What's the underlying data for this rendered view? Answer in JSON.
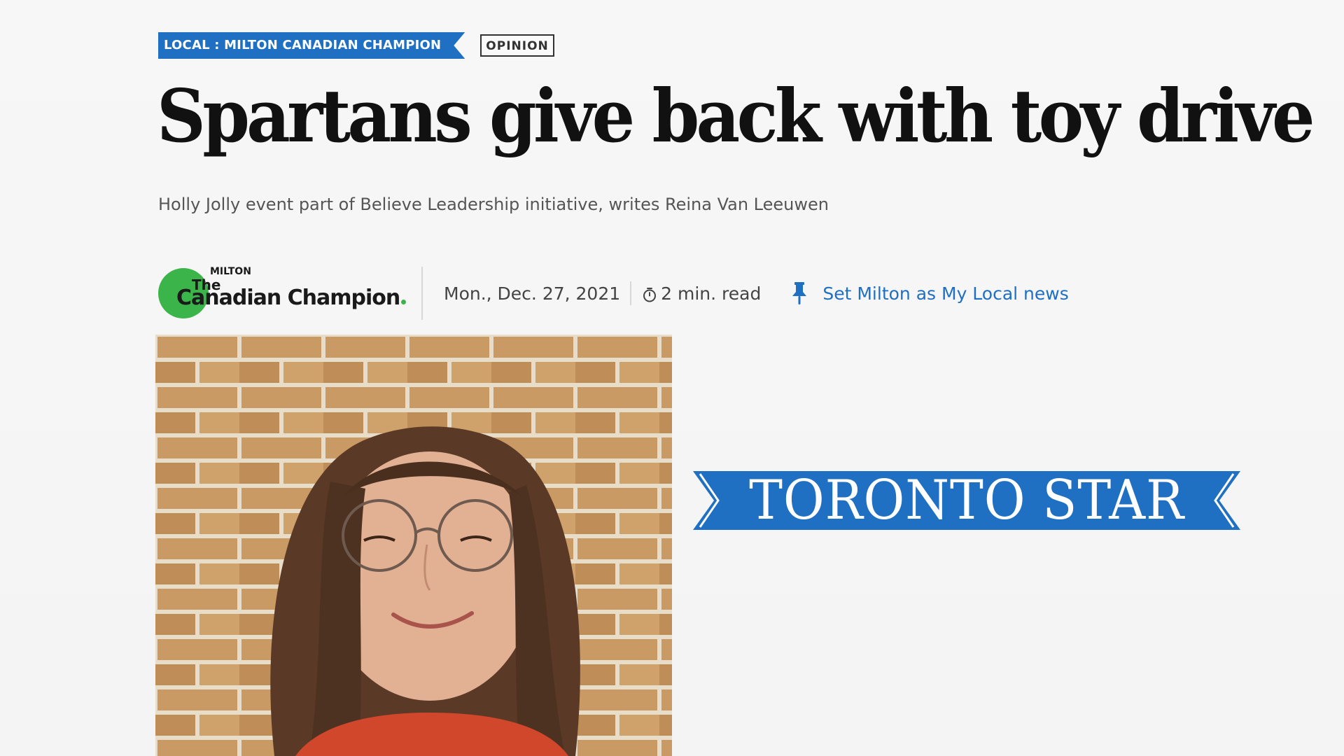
{
  "article": {
    "section_tag": "LOCAL : MILTON CANADIAN CHAMPION",
    "type_tag": "OPINION",
    "headline": "Spartans give back with toy drive",
    "subhead": "Holly Jolly event part of Believe Leadership initiative, writes Reina Van Leeuwen"
  },
  "publisher": {
    "logo_small": "MILTON",
    "logo_the": "The",
    "logo_name": "Canadian Champion",
    "logo_color": "#3bb54a"
  },
  "meta": {
    "date": "Mon., Dec. 27, 2021",
    "read_time": "2 min. read",
    "read_time_icon": "timer-icon",
    "set_local_icon": "pin-icon",
    "set_local_label": "Set Milton as My Local news"
  },
  "photo": {
    "icon": "portrait-photo"
  },
  "brand": {
    "name": "TORONTO STAR",
    "color": "#1f6fc2"
  },
  "colors": {
    "accent": "#1f6fc2",
    "headline": "#111111",
    "subhead": "#555555"
  }
}
